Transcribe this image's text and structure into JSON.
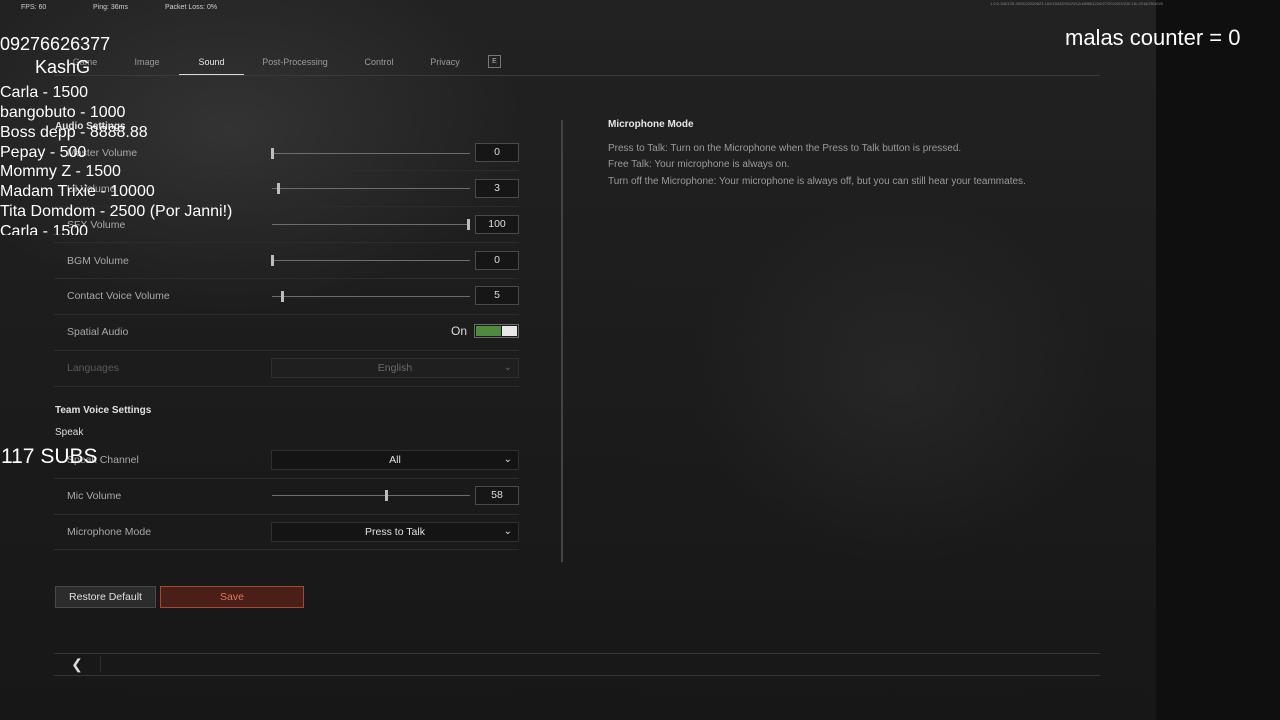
{
  "hud": {
    "fps": "FPS: 60",
    "ping": "Ping: 36ms",
    "packet_loss": "Packet Loss: 0%",
    "build": "1.0.0.118/120-33/2022020623-160/1543/2/0/2/0/12/48/98/1226/27/2022/03/2/0/-16/-/0/18/25/2/0/0"
  },
  "tabs": [
    {
      "label": "Game",
      "active": false
    },
    {
      "label": "Image",
      "active": false
    },
    {
      "label": "Sound",
      "active": true
    },
    {
      "label": "Post-Processing",
      "active": false
    },
    {
      "label": "Control",
      "active": false
    },
    {
      "label": "Privacy",
      "active": false
    },
    {
      "label": "E",
      "active": false
    }
  ],
  "audio_settings": {
    "title": "Audio Settings",
    "rows": [
      {
        "label": "Master Volume",
        "value": "0",
        "level": 0
      },
      {
        "label": "UI Volume",
        "value": "3",
        "level": 3
      },
      {
        "label": "SFX Volume",
        "value": "100",
        "level": 100
      },
      {
        "label": "BGM Volume",
        "value": "0",
        "level": 0
      },
      {
        "label": "Contact Voice Volume",
        "value": "5",
        "level": 5
      }
    ],
    "spatial_audio": {
      "label": "Spatial Audio",
      "state": "On"
    },
    "languages": {
      "label": "Languages",
      "value": "English"
    }
  },
  "team_voice": {
    "title": "Team Voice Settings",
    "speak": "Speak",
    "speak_channel": {
      "label": "Speak Channel",
      "value": "All"
    },
    "mic_volume": {
      "label": "Mic Volume",
      "value": "58",
      "level": 58
    },
    "microphone_mode": {
      "label": "Microphone Mode",
      "value": "Press to Talk"
    }
  },
  "help": {
    "title": "Microphone Mode",
    "lines": [
      "Press to Talk: Turn on the Microphone when the Press to Talk button is pressed.",
      "Free Talk: Your microphone is always on.",
      "Turn off the Microphone: Your microphone is always off, but you can still hear your teammates."
    ]
  },
  "buttons": {
    "restore": "Restore Default",
    "save": "Save",
    "back_icon": "chevron-left-icon"
  },
  "overlay": {
    "phone": "09276626377",
    "name": "KashG",
    "donations": [
      "Carla - 1500",
      "bangobuto - 1000",
      "Boss depp - 8888.88",
      "Pepay - 500",
      "Mommy Z - 1500",
      "Madam Trixie - 10000",
      "Tita Domdom - 2500 (Por Janni!)",
      "Carla - 1500"
    ],
    "subs": "117 SUBS",
    "counter": "malas counter = 0"
  },
  "colors": {
    "toggle_on": "#4f8a3e",
    "save_border": "#a24a34",
    "save_text": "#e2755a"
  }
}
